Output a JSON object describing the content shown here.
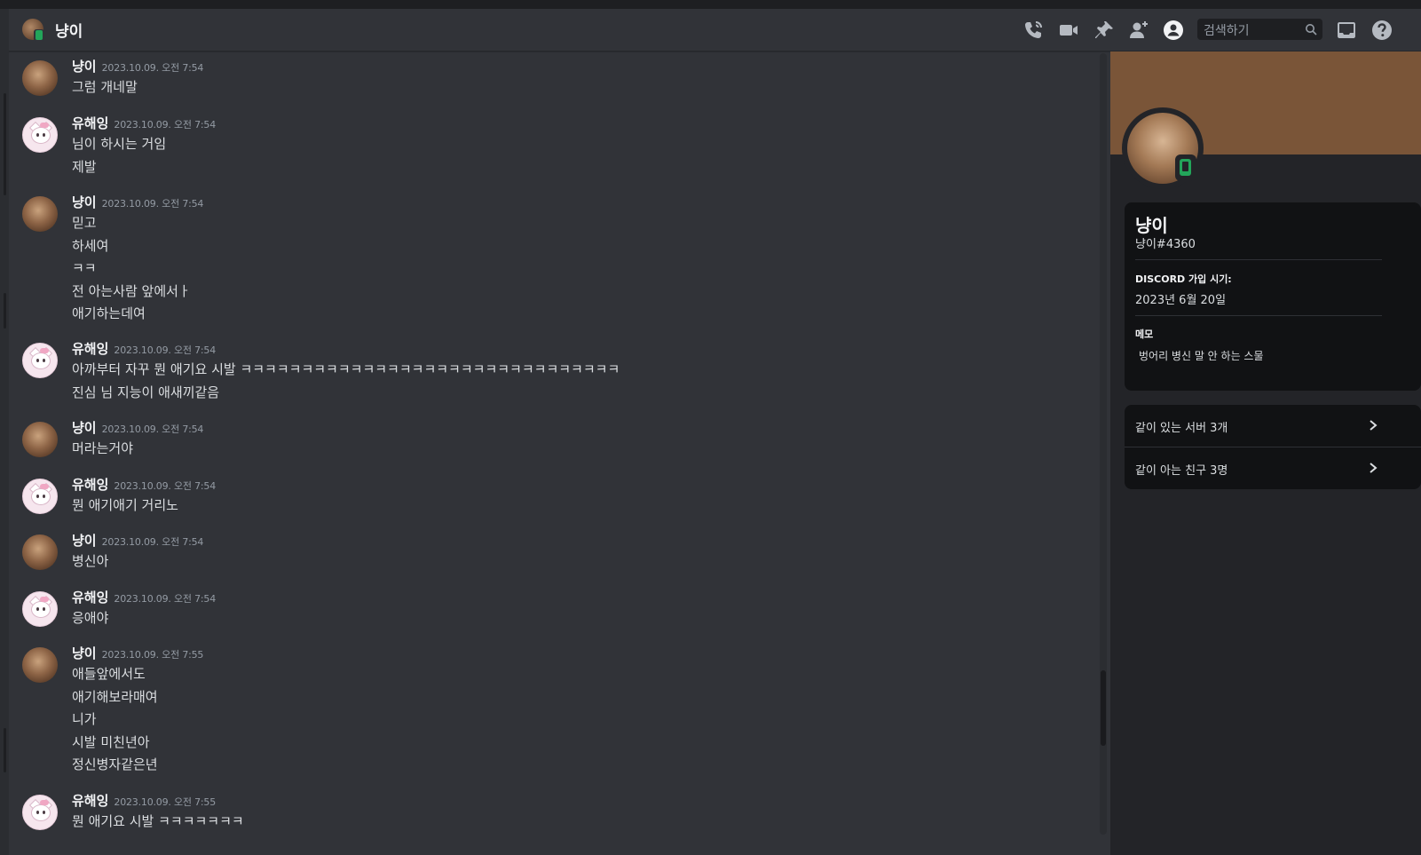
{
  "header": {
    "dm_name": "냥이",
    "search_placeholder": "검색하기",
    "icons": [
      "voice-call-icon",
      "video-call-icon",
      "pin-icon",
      "add-friend-icon",
      "user-profile-icon",
      "inbox-icon",
      "help-icon"
    ]
  },
  "messages": [
    {
      "author": "냥이",
      "avatar": "cat",
      "timestamp": "2023.10.09. 오전 7:54",
      "lines": [
        "그럼 개네말"
      ]
    },
    {
      "author": "유해잉",
      "avatar": "kitty",
      "timestamp": "2023.10.09. 오전 7:54",
      "lines": [
        "님이 하시는 거임",
        "제발"
      ]
    },
    {
      "author": "냥이",
      "avatar": "cat",
      "timestamp": "2023.10.09. 오전 7:54",
      "lines": [
        "믿고",
        "하세여",
        "ㅋㅋ",
        "전 아는사람 앞에서ㅏ",
        "애기하는데여"
      ]
    },
    {
      "author": "유해잉",
      "avatar": "kitty",
      "timestamp": "2023.10.09. 오전 7:54",
      "lines": [
        "아까부터 자꾸 뭔 애기요 시발 ㅋㅋㅋㅋㅋㅋㅋㅋㅋㅋㅋㅋㅋㅋㅋㅋㅋㅋㅋㅋㅋㅋㅋㅋㅋㅋㅋㅋㅋㅋㅋ",
        "진심 님 지능이 애새끼같음"
      ]
    },
    {
      "author": "냥이",
      "avatar": "cat",
      "timestamp": "2023.10.09. 오전 7:54",
      "lines": [
        "머라는거야"
      ]
    },
    {
      "author": "유해잉",
      "avatar": "kitty",
      "timestamp": "2023.10.09. 오전 7:54",
      "lines": [
        "뭔 애기애기 거리노"
      ]
    },
    {
      "author": "냥이",
      "avatar": "cat",
      "timestamp": "2023.10.09. 오전 7:54",
      "lines": [
        "병신아"
      ]
    },
    {
      "author": "유해잉",
      "avatar": "kitty",
      "timestamp": "2023.10.09. 오전 7:54",
      "lines": [
        "응애야"
      ]
    },
    {
      "author": "냥이",
      "avatar": "cat",
      "timestamp": "2023.10.09. 오전 7:55",
      "lines": [
        "애들앞에서도",
        "애기해보라매여",
        "니가",
        "시발 미친년아",
        "정신병자같은년"
      ]
    },
    {
      "author": "유해잉",
      "avatar": "kitty",
      "timestamp": "2023.10.09. 오전 7:55",
      "lines": [
        "뭔 애기요 시발 ㅋㅋㅋㅋㅋㅋㅋ"
      ]
    }
  ],
  "profile": {
    "display_name": "냥이",
    "username": "냥이#4360",
    "member_since_label": "DISCORD 가입 시기:",
    "member_since": "2023년 6월 20일",
    "note_label": "메모",
    "note": "벙어리 병신 말 안 하는 스물",
    "mutual_servers": "같이 있는 서버 3개",
    "mutual_friends": "같이 아는 친구 3명",
    "banner_color": "#7a5538",
    "status": "online-mobile",
    "status_color": "#23a55a"
  }
}
